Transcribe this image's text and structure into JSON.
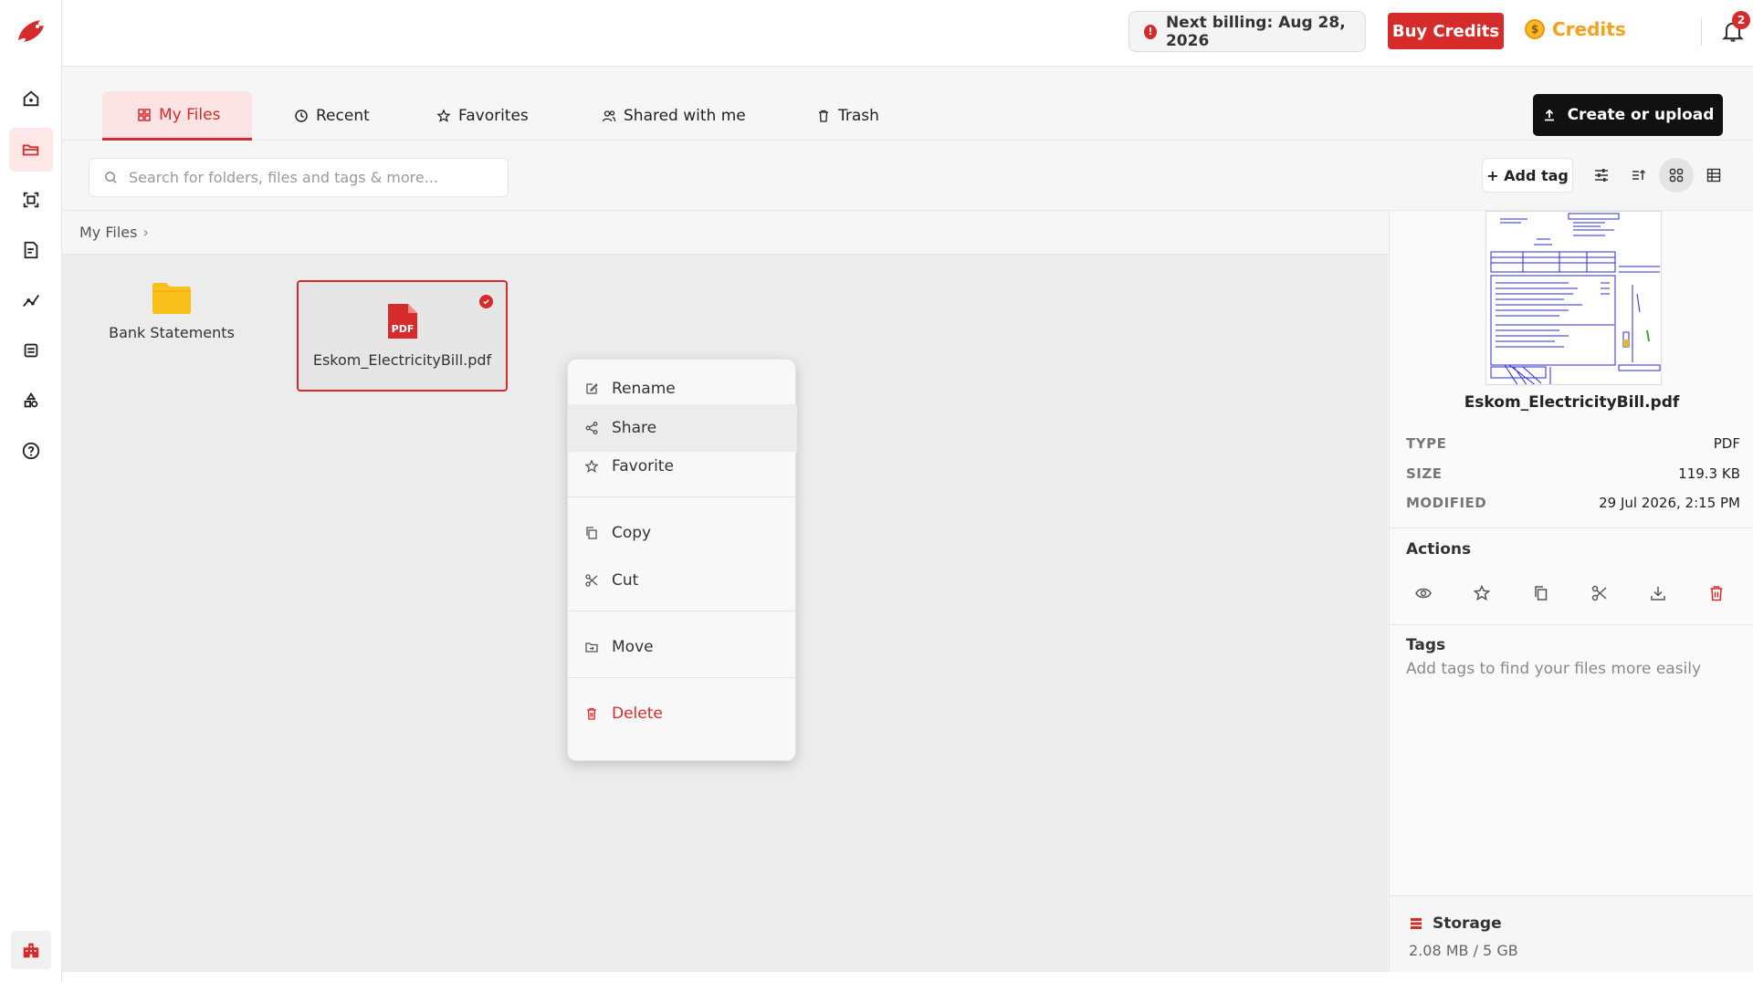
{
  "topbar": {
    "billing_text": "Next billing: Aug 28, 2026",
    "buy_label": "Buy Credits",
    "credits_label": "Credits",
    "notification_count": "2",
    "accent_color": "#d62b2b"
  },
  "sidebar": {
    "items": [
      {
        "name": "home-icon"
      },
      {
        "name": "folder-icon",
        "active": true
      },
      {
        "name": "scan-icon"
      },
      {
        "name": "document-add-icon"
      },
      {
        "name": "analytics-icon"
      },
      {
        "name": "list-icon"
      },
      {
        "name": "shapes-icon"
      },
      {
        "name": "help-icon"
      }
    ],
    "bottom": {
      "name": "building-icon"
    }
  },
  "tabs": [
    {
      "label": "My Files",
      "active": true
    },
    {
      "label": "Recent"
    },
    {
      "label": "Favorites"
    },
    {
      "label": "Shared with me"
    },
    {
      "label": "Trash"
    }
  ],
  "create_label": "Create or upload",
  "search": {
    "placeholder": "Search for folders, files and tags & more..."
  },
  "toolbar": {
    "add_tag_label": "+ Add tag"
  },
  "breadcrumb": {
    "label": "My Files",
    "separator": "›"
  },
  "items": {
    "folder": {
      "label": "Bank Statements"
    },
    "file": {
      "label": "Eskom_ElectricityBill.pdf",
      "badge": "PDF"
    }
  },
  "context_menu": {
    "rename": "Rename",
    "share": "Share",
    "favorite": "Favorite",
    "copy": "Copy",
    "cut": "Cut",
    "move": "Move",
    "delete": "Delete"
  },
  "details": {
    "file_name": "Eskom_ElectricityBill.pdf",
    "type_key": "TYPE",
    "type_val": "PDF",
    "size_key": "SIZE",
    "size_val": "119.3 KB",
    "modified_key": "MODIFIED",
    "modified_val": "29 Jul 2026, 2:15 PM",
    "actions_title": "Actions",
    "tags_title": "Tags",
    "tags_hint": "Add tags to find your files more easily",
    "storage_title": "Storage",
    "storage_value": "2.08 MB / 5 GB"
  }
}
